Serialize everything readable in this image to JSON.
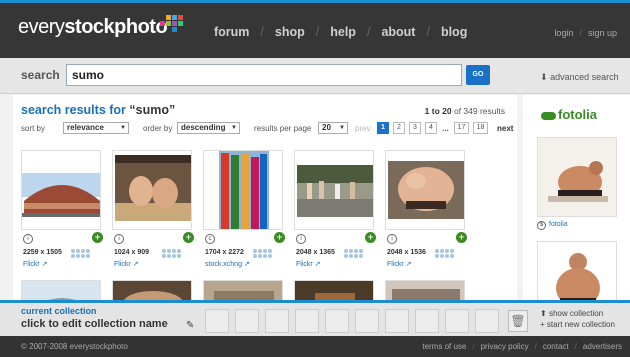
{
  "header": {
    "logo_light": "every",
    "logo_bold": "stockphoto",
    "nav": [
      "forum",
      "shop",
      "help",
      "about",
      "blog"
    ],
    "login": "login",
    "signup": "sign up"
  },
  "search": {
    "label": "search",
    "value": "sumo",
    "go": "GO",
    "advanced": "advanced search"
  },
  "results": {
    "title_prefix": "search results for ",
    "query_quoted": "“sumo”",
    "count_range": "1 to 20",
    "count_total": "of 349 results",
    "sort_label": "sort by",
    "sort_value": "relevance",
    "order_label": "order by",
    "order_value": "descending",
    "per_page_label": "results per page",
    "per_page_value": "20",
    "prev": "prev",
    "pages": [
      "1",
      "2",
      "3",
      "4",
      "...",
      "17",
      "18"
    ],
    "next": "next",
    "current_page": "1"
  },
  "thumbnails": [
    {
      "dims": "2259 x 1505",
      "source": "Flickr",
      "license": "i"
    },
    {
      "dims": "1024 x 909",
      "source": "Flickr",
      "license": "i"
    },
    {
      "dims": "1704 x 2272",
      "source": "stock.xchng",
      "license": "c"
    },
    {
      "dims": "2048 x 1365",
      "source": "Flickr",
      "license": "i"
    },
    {
      "dims": "2048 x 1536",
      "source": "Flickr",
      "license": "i"
    }
  ],
  "sidebar": {
    "brand": "fotolia",
    "source_label": "fotolia"
  },
  "collection": {
    "title": "current collection",
    "edit_label": "click to edit collection name",
    "show": "show collection",
    "new": "start new collection"
  },
  "footer": {
    "copyright": "© 2007-2008 everystockphoto",
    "links": [
      "terms of use",
      "privacy policy",
      "contact",
      "advertisers"
    ]
  },
  "colors": {
    "accent_blue": "#1a8ed1",
    "link_blue": "#1a6fb5",
    "plus_green": "#3a8c22",
    "header_dark": "#363636"
  }
}
